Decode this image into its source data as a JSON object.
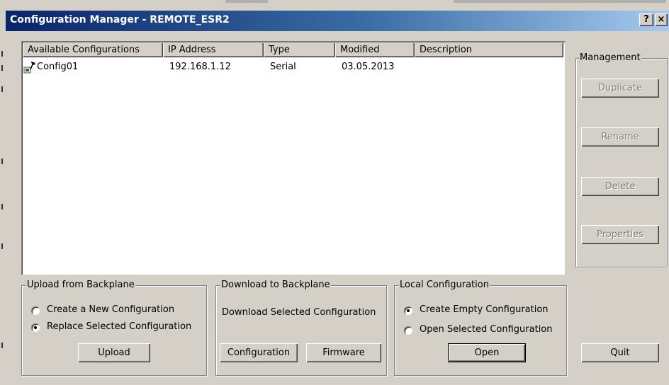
{
  "window": {
    "title": "Configuration Manager - REMOTE_ESR2",
    "help_button": "?",
    "close_button": "×"
  },
  "list": {
    "columns": [
      "Available Configurations",
      "IP Address",
      "Type",
      "Modified",
      "Description"
    ],
    "rows": [
      {
        "icon": "configuration-file-icon",
        "name": "Config01",
        "ip": "192.168.1.12",
        "type": "Serial",
        "modified": "03.05.2013",
        "description": ""
      }
    ]
  },
  "management": {
    "label": "Management",
    "duplicate": "Duplicate",
    "rename": "Rename",
    "delete": "Delete",
    "properties": "Properties"
  },
  "upload": {
    "label": "Upload from Backplane",
    "option_new": "Create a New Configuration",
    "option_replace": "Replace Selected Configuration",
    "selected": "Replace Selected Configuration",
    "button": "Upload"
  },
  "download": {
    "label": "Download to Backplane",
    "text": "Download Selected Configuration",
    "configuration_button": "Configuration",
    "firmware_button": "Firmware"
  },
  "local": {
    "label": "Local Configuration",
    "option_empty": "Create Empty Configuration",
    "option_open": "Open Selected Configuration",
    "selected": "Create Empty Configuration",
    "button": "Open"
  },
  "quit_button": "Quit"
}
